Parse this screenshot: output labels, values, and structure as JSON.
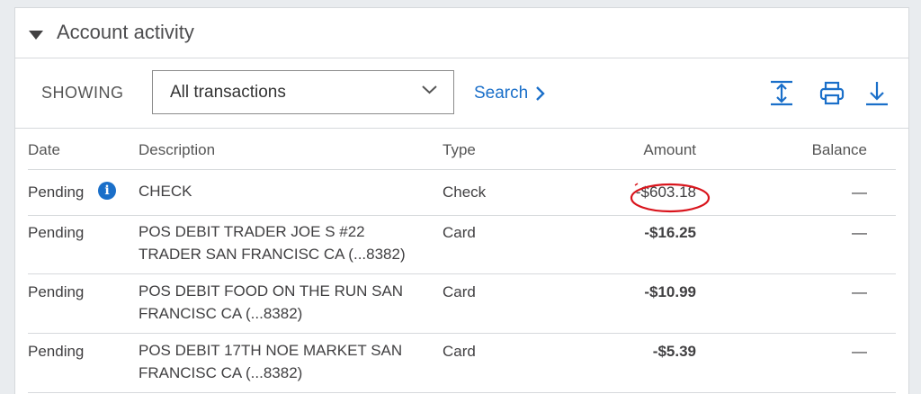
{
  "panel": {
    "title": "Account activity"
  },
  "toolbar": {
    "showing_label": "SHOWING",
    "filter_value": "All transactions",
    "search_label": "Search"
  },
  "icons": {
    "expand": "expand-vertical-icon",
    "print": "print-icon",
    "download": "download-icon",
    "info": "info-icon"
  },
  "table": {
    "headers": [
      "Date",
      "Description",
      "Type",
      "Amount",
      "Balance"
    ],
    "rows": [
      {
        "date": "Pending",
        "description": "CHECK",
        "type": "Check",
        "amount": "-$603.18",
        "balance": "—"
      },
      {
        "date": "Pending",
        "description": "POS DEBIT TRADER JOE S #22 TRADER SAN FRANCISC CA (...8382)",
        "type": "Card",
        "amount": "-$16.25",
        "balance": "—"
      },
      {
        "date": "Pending",
        "description": "POS DEBIT FOOD ON THE RUN SAN FRANCISC CA (...8382)",
        "type": "Card",
        "amount": "-$10.99",
        "balance": "—"
      },
      {
        "date": "Pending",
        "description": "POS DEBIT 17TH NOE MARKET SAN FRANCISC CA (...8382)",
        "type": "Card",
        "amount": "-$5.39",
        "balance": "—"
      }
    ]
  },
  "colors": {
    "link": "#1a6fc9",
    "annotation": "#d9141c"
  }
}
